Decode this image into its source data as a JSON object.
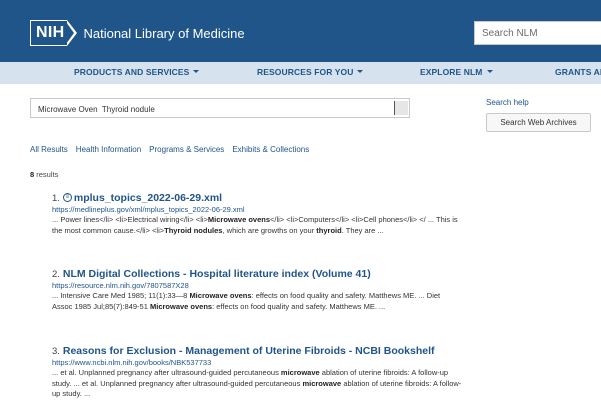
{
  "header": {
    "logo_abbr": "NIH",
    "logo_text": "National Library of Medicine",
    "search_placeholder": "Search NLM",
    "brand_color": "#20558a"
  },
  "nav": {
    "items": [
      {
        "label": "PRODUCTS AND SERVICES"
      },
      {
        "label": "RESOURCES FOR YOU"
      },
      {
        "label": "EXPLORE NLM"
      },
      {
        "label": "GRANTS AN"
      }
    ]
  },
  "search": {
    "query": "Microwave Oven  Thyroid nodule",
    "help_label": "Search help",
    "web_archives_label": "Search Web Archives"
  },
  "tabs": [
    {
      "label": "All Results"
    },
    {
      "label": "Health Information"
    },
    {
      "label": "Programs & Services"
    },
    {
      "label": "Exhibits & Collections"
    }
  ],
  "results_count": "8",
  "results_label": " results",
  "results": [
    {
      "number": "1.",
      "icon": "document-icon",
      "title": "mplus_topics_2022-06-29.xml",
      "url": "https://medlineplus.gov/xml/mplus_topics_2022-06-29.xml",
      "snippet": [
        {
          "t": "... Power lines</li> <li>Electrical wiring</li> <li>",
          "b": false
        },
        {
          "t": "Microwave ovens",
          "b": true
        },
        {
          "t": "</li> <li>Computers</li> <li>Cell phones</li> </ ... This is the most common cause.</li> <li>",
          "b": false
        },
        {
          "t": "Thyroid nodules",
          "b": true
        },
        {
          "t": ", which are growths on your ",
          "b": false
        },
        {
          "t": "thyroid",
          "b": true
        },
        {
          "t": ". They are ...",
          "b": false
        }
      ]
    },
    {
      "number": "2.",
      "title": "NLM Digital Collections - Hospital literature index (Volume 41)",
      "url": "https://resource.nlm.nih.gov/7807587X28",
      "snippet": [
        {
          "t": "... Intensive Care Med 1985; 11(1):33—8 ",
          "b": false
        },
        {
          "t": "Microwave ovens",
          "b": true
        },
        {
          "t": ": effects on food quality and safety. Matthews ME. ... Diet Assoc 1985 Jul;85(7):849-51 ",
          "b": false
        },
        {
          "t": "Microwave ovens",
          "b": true
        },
        {
          "t": ": effects on food quality and safety. Matthews ME. ...",
          "b": false
        }
      ]
    },
    {
      "number": "3.",
      "title": "Reasons for Exclusion - Management of Uterine Fibroids - NCBI Bookshelf",
      "url": "https://www.ncbi.nlm.nih.gov/books/NBK537733",
      "snippet": [
        {
          "t": "... et al. Unplanned pregnancy after ultrasound-guided percutaneous ",
          "b": false
        },
        {
          "t": "microwave",
          "b": true
        },
        {
          "t": " ablation of uterine fibroids: A follow-up study. ... et al. Unplanned pregnancy after ultrasound-guided percutaneous ",
          "b": false
        },
        {
          "t": "microwave",
          "b": true
        },
        {
          "t": " ablation of uterine fibroids: A follow-up study. ...",
          "b": false
        }
      ]
    }
  ]
}
